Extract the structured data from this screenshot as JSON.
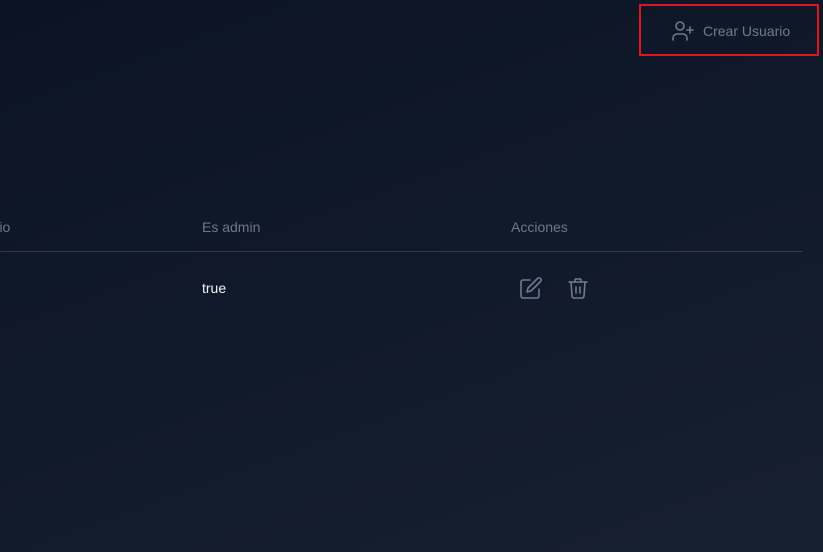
{
  "header": {
    "create_user_label": "Crear Usuario",
    "create_user_icon": "user-plus-icon"
  },
  "table": {
    "columns": [
      "ario",
      "Es admin",
      "Acciones"
    ],
    "rows": [
      {
        "usuario": "",
        "es_admin": "true",
        "actions": [
          "edit-icon",
          "trash-icon"
        ]
      }
    ]
  },
  "colors": {
    "highlight_border": "#e01520",
    "background": "#111a2b",
    "header_text": "#6b778b",
    "cell_text": "#f1f3f6",
    "icon": "#6d7a90"
  }
}
